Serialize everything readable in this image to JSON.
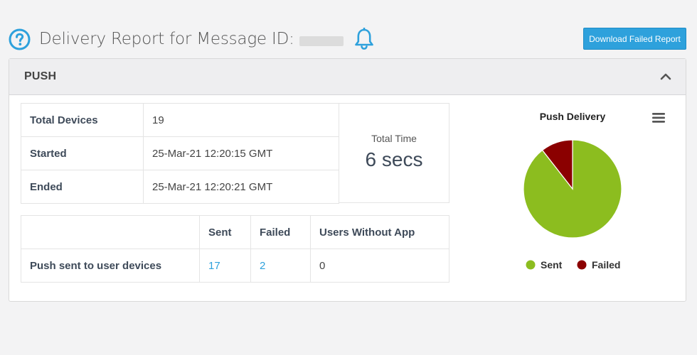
{
  "header": {
    "title": "Delivery Report for Message ID:",
    "help_icon": "help-circle-icon",
    "bell_icon": "bell-icon"
  },
  "actions": {
    "download_label": "Download Failed Report"
  },
  "panel": {
    "title": "PUSH",
    "collapse_icon": "chevron-up-icon"
  },
  "summary": [
    {
      "label": "Total Devices",
      "value": "19"
    },
    {
      "label": "Started",
      "value": "25-Mar-21 12:20:15 GMT"
    },
    {
      "label": "Ended",
      "value": "25-Mar-21 12:20:21 GMT"
    }
  ],
  "total_time": {
    "label": "Total Time",
    "value": "6 secs"
  },
  "push_table": {
    "headers": [
      "",
      "Sent",
      "Failed",
      "Users Without App"
    ],
    "row": {
      "label": "Push sent to user devices",
      "sent": "17",
      "failed": "2",
      "without_app": "0"
    }
  },
  "colors": {
    "accent": "#2ea1dc",
    "sent": "#8cbd1f",
    "failed": "#8b0000"
  },
  "chart_data": {
    "type": "pie",
    "title": "Push Delivery",
    "categories": [
      "Sent",
      "Failed"
    ],
    "values": [
      17,
      2
    ],
    "colors": [
      "#8cbd1f",
      "#8b0000"
    ],
    "legend": "bottom",
    "menu_icon": "hamburger-menu-icon"
  }
}
